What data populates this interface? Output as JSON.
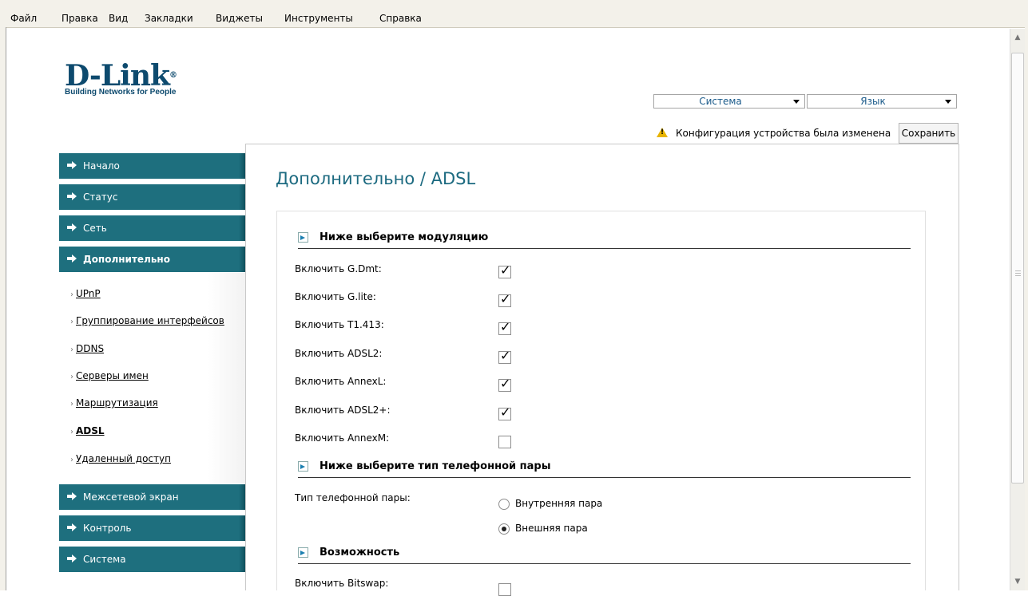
{
  "browser": {
    "menu": [
      "Файл",
      "Правка",
      "Вид",
      "Закладки",
      "Виджеты",
      "Инструменты",
      "Справка"
    ]
  },
  "logo": {
    "brand": "D-Link",
    "registered": "®",
    "tagline": "Building Networks for People"
  },
  "top": {
    "system_select": "Система",
    "language_select": "Язык",
    "notice": "Конфигурация устройства была изменена",
    "save_label": "Сохранить"
  },
  "sidebar": {
    "items": [
      {
        "label": "Начало"
      },
      {
        "label": "Статус"
      },
      {
        "label": "Сеть"
      },
      {
        "label": "Дополнительно"
      },
      {
        "label": "Межсетевой экран"
      },
      {
        "label": "Контроль"
      },
      {
        "label": "Система"
      }
    ],
    "subitems": [
      {
        "label": "UPnP"
      },
      {
        "label": "Группирование интерфейсов"
      },
      {
        "label": "DDNS"
      },
      {
        "label": "Серверы имен"
      },
      {
        "label": "Маршрутизация"
      },
      {
        "label": "ADSL"
      },
      {
        "label": "Удаленный доступ"
      }
    ],
    "bullet": "›"
  },
  "main": {
    "title": "Дополнительно / ADSL",
    "modulation": {
      "title": "Ниже выберите модуляцию",
      "fields": [
        {
          "label": "Включить G.Dmt:",
          "checked": true
        },
        {
          "label": "Включить G.lite:",
          "checked": true
        },
        {
          "label": "Включить T1.413:",
          "checked": true
        },
        {
          "label": "Включить ADSL2:",
          "checked": true
        },
        {
          "label": "Включить AnnexL:",
          "checked": true
        },
        {
          "label": "Включить ADSL2+:",
          "checked": true
        },
        {
          "label": "Включить AnnexM:",
          "checked": false
        }
      ]
    },
    "pair": {
      "title": "Ниже выберите тип телефонной пары",
      "label": "Тип телефонной пары:",
      "options": [
        {
          "label": "Внутренняя пара",
          "selected": false
        },
        {
          "label": "Внешняя пара",
          "selected": true
        }
      ]
    },
    "features": {
      "title": "Возможность",
      "fields": [
        {
          "label": "Включить Bitswap:",
          "checked": false
        }
      ]
    }
  },
  "colors": {
    "nav": "#1e6f7e",
    "title": "#1c6a80",
    "logo": "#0d4a6e"
  }
}
